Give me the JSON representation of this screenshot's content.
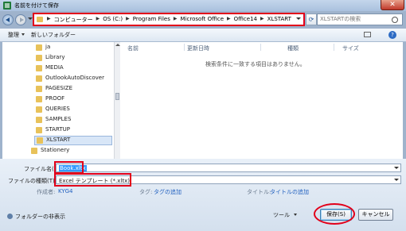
{
  "window": {
    "title": "名前を付けて保存",
    "close_glyph": "✕"
  },
  "address": {
    "crumbs": [
      "コンピューター",
      "OS (C:)",
      "Program Files",
      "Microsoft Office",
      "Office14",
      "XLSTART"
    ],
    "refresh_glyph": "⟳"
  },
  "search": {
    "placeholder": "XLSTARTの検索"
  },
  "toolbar": {
    "organize": "整理",
    "new_folder": "新しいフォルダー",
    "help_glyph": "?"
  },
  "nav_tree": {
    "items": [
      "ja",
      "Library",
      "MEDIA",
      "OutlookAutoDiscover",
      "PAGESIZE",
      "PROOF",
      "QUERIES",
      "SAMPLES",
      "STARTUP",
      "XLSTART",
      "Stationery"
    ],
    "selected": "XLSTART"
  },
  "file_list": {
    "columns": [
      "名前",
      "更新日時",
      "種類",
      "サイズ"
    ],
    "empty_message": "検索条件に一致する項目はありません。"
  },
  "form": {
    "filename_label": "ファイル名(N):",
    "filename_value": "Book.xltx",
    "filetype_label": "ファイルの種類(T):",
    "filetype_value": "Excel テンプレート (*.xltx)",
    "author_label": "作成者:",
    "author_value": "KYG4",
    "tags_label": "タグ:",
    "tags_value": "タグの追加",
    "title_label": "タイトル:",
    "title_value": "タイトルの追加"
  },
  "footer": {
    "hide_folders": "フォルダーの非表示",
    "tools": "ツール",
    "save": "保存(S)",
    "cancel": "キャンセル"
  },
  "colors": {
    "highlight_red": "#e2001a",
    "link_blue": "#1f5fbf",
    "selection_blue": "#3399ff"
  }
}
